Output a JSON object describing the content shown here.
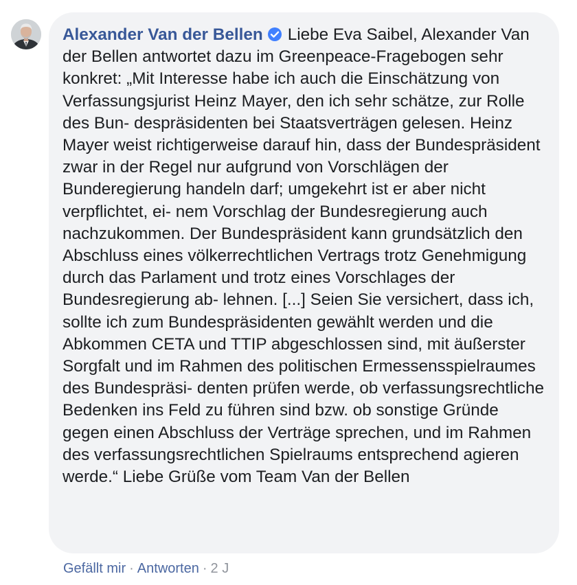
{
  "comment": {
    "author": "Alexander Van der Bellen",
    "author_icons": {
      "avatar": "profile-photo",
      "verified": "verified-badge-icon"
    },
    "text": "Liebe Eva Saibel, Alexander Van der Bellen antwortet dazu im Greenpeace-Fragebogen sehr konkret: „Mit Interesse habe ich auch die Einschätzung von Verfassungsjurist Heinz Mayer, den ich sehr schätze, zur Rolle des Bun- despräsidenten bei Staatsverträgen gelesen. Heinz Mayer weist richtigerweise darauf hin, dass der Bundespräsident zwar in der Regel nur aufgrund von Vorschlägen der Bunderegierung handeln darf; umgekehrt ist er aber nicht verpflichtet, ei- nem Vorschlag der Bundesregierung auch nachzukommen. Der Bundespräsident kann grundsätzlich den Abschluss eines völkerrechtlichen Vertrags trotz Genehmigung durch das Parlament und trotz eines Vorschlages der Bundesregierung ab- lehnen. [...] Seien Sie versichert, dass ich, sollte ich zum Bundespräsidenten gewählt werden und die Abkommen CETA und TTIP abgeschlossen sind, mit äußerster Sorgfalt und im Rahmen des politischen Ermessensspielraumes des Bundespräsi- denten prüfen werde, ob verfassungsrechtliche Bedenken ins Feld zu führen sind bzw. ob sonstige Gründe gegen einen Abschluss der Verträge sprechen, und im Rahmen des verfassungsrechtlichen Spielraums entsprechend agieren werde.“ Liebe Grüße vom Team Van der Bellen",
    "actions": {
      "like": "Gefällt mir",
      "reply": "Antworten",
      "separator": "·",
      "time": "2 J"
    }
  },
  "colors": {
    "bubble": "#f2f3f5",
    "author": "#385898",
    "link": "#4b67a1",
    "meta": "#90949c",
    "text": "#1c1e21",
    "verified": "#4080ff"
  }
}
